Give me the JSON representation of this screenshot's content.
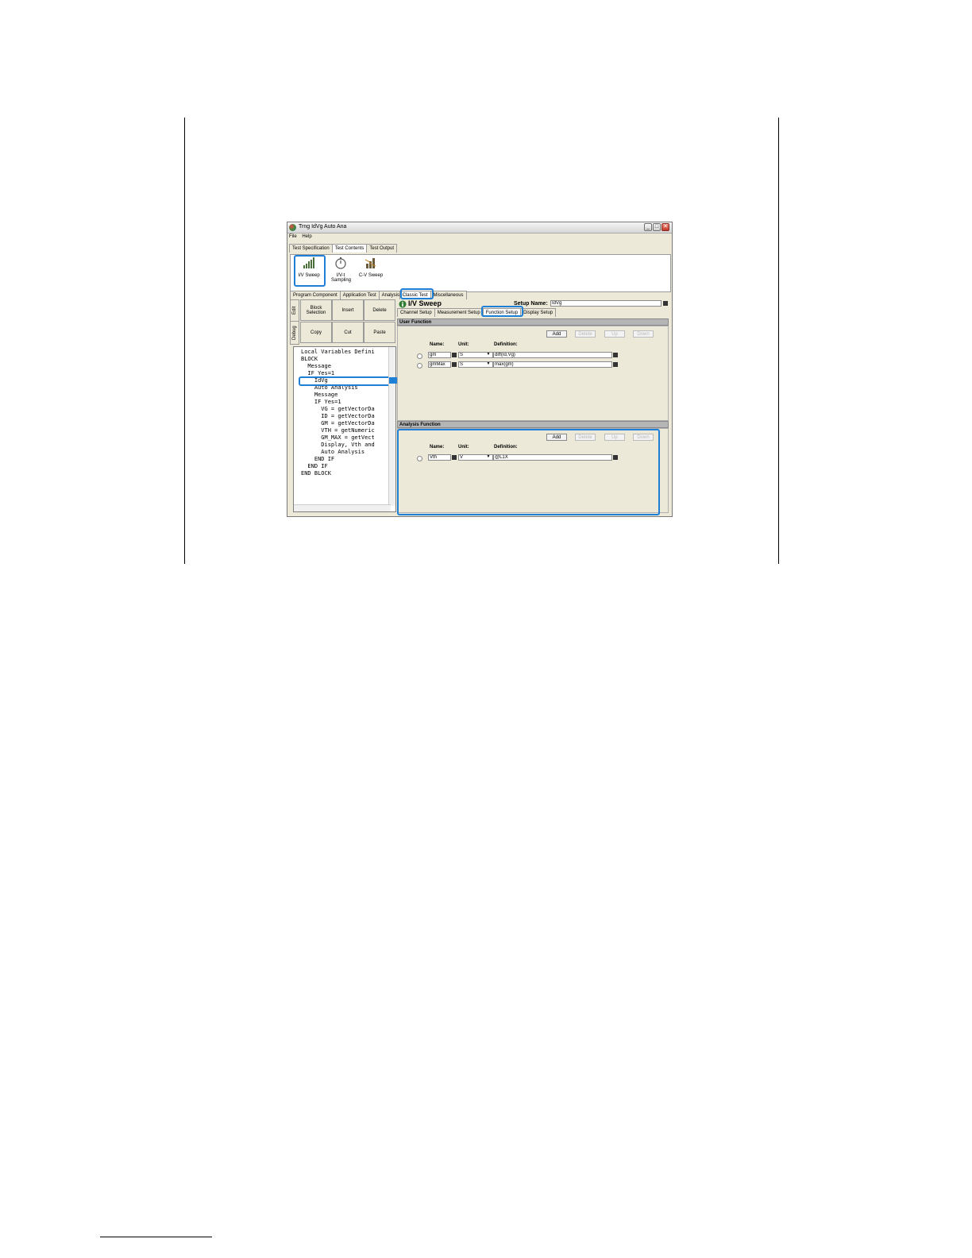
{
  "window": {
    "title": "Trng IdVg Auto Ana",
    "menu": [
      "File",
      "Help"
    ],
    "main_tabs": [
      "Test Specification",
      "Test Contents",
      "Test Output"
    ],
    "active_main_tab": "Test Contents"
  },
  "toolbox": {
    "items": [
      {
        "label": "I/V Sweep",
        "icon": "iv-sweep-icon"
      },
      {
        "label": "I/V-t Sampling",
        "icon": "stopwatch-icon"
      },
      {
        "label": "C-V Sweep",
        "icon": "cv-sweep-icon"
      }
    ],
    "category_tabs": [
      "Program Component",
      "Application Test",
      "Analysis",
      "Classic Test",
      "Miscellaneous"
    ],
    "active_category_tab": "Classic Test"
  },
  "editor": {
    "side_tabs": [
      "Edit",
      "Debug"
    ],
    "buttons": [
      "Block Selection",
      "Insert",
      "Delete",
      "Copy",
      "Cut",
      "Paste"
    ],
    "code_lines": [
      "Local Variables Defini",
      "BLOCK",
      "  Message",
      "  IF Yes=1",
      "    IdVg",
      "    Auto Analysis",
      "    Message",
      "    IF Yes=1",
      "      VG = getVectorDa",
      "      ID = getVectorDa",
      "      GM = getVectorDa",
      "      VTH = getNumeric",
      "      GM_MAX = getVect",
      "      Display, Vth and",
      "      Auto Analysis",
      "    END IF",
      "  END IF",
      "END BLOCK"
    ],
    "selected_line": "IdVg"
  },
  "setup": {
    "title": "I/V Sweep",
    "setup_name_label": "Setup Name:",
    "setup_name_value": "IdVg",
    "tabs": [
      "Channel Setup",
      "Measurement Setup",
      "Function Setup",
      "Display Setup"
    ],
    "active_tab": "Function Setup",
    "user_function": {
      "header": "User Function",
      "buttons": [
        "Add",
        "Delete",
        "Up",
        "Down"
      ],
      "columns": [
        "Name:",
        "Unit:",
        "Definition:"
      ],
      "rows": [
        {
          "name": "gm",
          "unit": "S",
          "definition": "diff(Id,Vg)"
        },
        {
          "name": "gmMax",
          "unit": "S",
          "definition": "max(gm)"
        }
      ]
    },
    "analysis_function": {
      "header": "Analysis Function",
      "buttons": [
        "Add",
        "Delete",
        "Up",
        "Down"
      ],
      "columns": [
        "Name:",
        "Unit:",
        "Definition:"
      ],
      "rows": [
        {
          "name": "Vth",
          "unit": "V",
          "definition": "@L1X"
        }
      ]
    }
  },
  "colors": {
    "highlight": "#1e7fd6",
    "section_header": "#b5b5b5",
    "window_bg": "#ece9d8"
  }
}
